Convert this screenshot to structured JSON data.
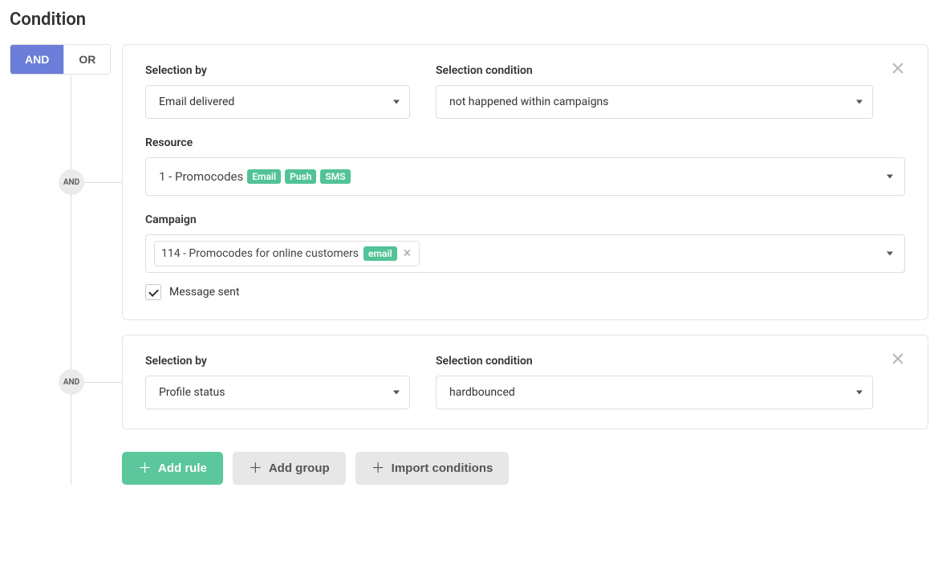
{
  "page": {
    "title": "Condition"
  },
  "logic": {
    "and_label": "AND",
    "or_label": "OR",
    "active": "AND",
    "node_label": "AND"
  },
  "labels": {
    "selection_by": "Selection by",
    "selection_condition": "Selection condition",
    "resource": "Resource",
    "campaign": "Campaign"
  },
  "rule1": {
    "selection_by": "Email delivered",
    "selection_condition": "not happened within campaigns",
    "resource": {
      "prefix": "1 - Promocodes",
      "tags": [
        "Email",
        "Push",
        "SMS"
      ]
    },
    "campaign": {
      "text": "114 - Promocodes for online customers",
      "tag": "email"
    },
    "checkbox": {
      "label": "Message sent",
      "checked": true
    }
  },
  "rule2": {
    "selection_by": "Profile status",
    "selection_condition": "hardbounced"
  },
  "actions": {
    "add_rule": "Add rule",
    "add_group": "Add group",
    "import": "Import conditions"
  }
}
